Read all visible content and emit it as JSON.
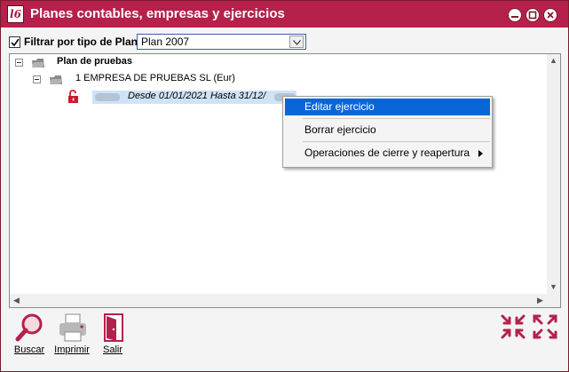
{
  "window": {
    "title": "Planes contables, empresas y ejercicios",
    "app_icon": "l6-app-icon",
    "accent_color": "#b5214a"
  },
  "filter": {
    "checked": true,
    "label": "Filtrar por tipo de Plan",
    "select_value": "Plan 2007"
  },
  "tree": {
    "nodes": [
      {
        "label": "Plan de pruebas",
        "level": 0,
        "expanded": true
      },
      {
        "label": "1 EMPRESA DE PRUEBAS SL (Eur)",
        "level": 1,
        "expanded": true
      },
      {
        "label": "Desde 01/01/2021  Hasta 31/12/",
        "level": 2,
        "selected": true,
        "icon": "lock-open-icon"
      }
    ]
  },
  "context_menu": {
    "items": [
      {
        "label": "Editar ejercicio",
        "active": true,
        "has_submenu": false
      },
      {
        "label": "Borrar ejercicio",
        "active": false,
        "has_submenu": false
      },
      {
        "label": "Operaciones de cierre y reapertura",
        "active": false,
        "has_submenu": true
      }
    ]
  },
  "toolbar": {
    "buscar": "Buscar",
    "imprimir": "Imprimir",
    "salir": "Salir"
  },
  "icons": [
    "search-icon",
    "printer-icon",
    "exit-door-icon",
    "collapse-all-icon",
    "expand-all-icon"
  ]
}
